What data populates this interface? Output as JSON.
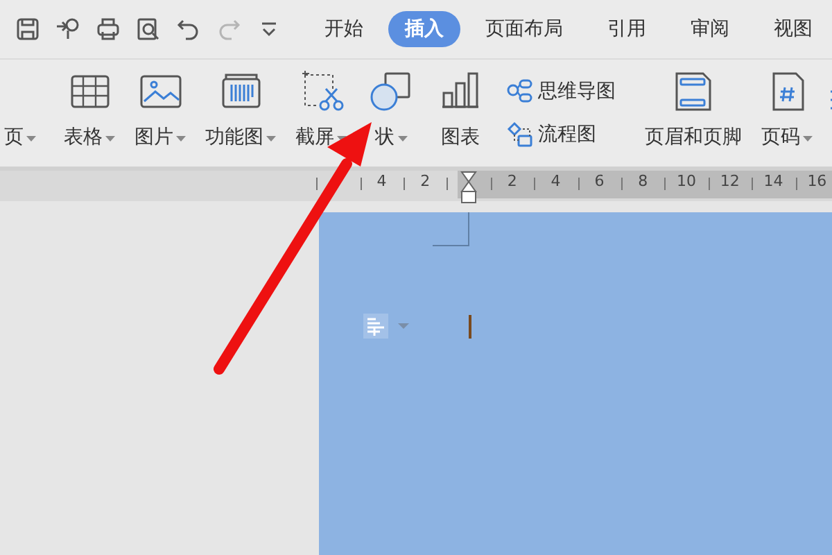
{
  "quick_access": [
    {
      "disabled": false
    },
    {
      "disabled": false
    },
    {
      "disabled": false
    },
    {
      "disabled": false
    },
    {
      "disabled": false
    },
    {
      "disabled": true
    },
    {
      "disabled": false
    }
  ],
  "tabs": [
    {
      "label": "开始",
      "selected": false
    },
    {
      "label": "插入",
      "selected": true
    },
    {
      "label": "页面布局",
      "selected": false
    },
    {
      "label": "引用",
      "selected": false
    },
    {
      "label": "审阅",
      "selected": false
    },
    {
      "label": "视图",
      "selected": false
    }
  ],
  "ribbon": {
    "sections": [
      {
        "items": [
          {
            "kind": "large",
            "label": "页",
            "dropdown": true
          }
        ]
      },
      {
        "items": [
          {
            "kind": "large",
            "label": "表格",
            "dropdown": true
          },
          {
            "kind": "large",
            "label": "图片",
            "dropdown": true
          },
          {
            "kind": "large",
            "label": "功能图",
            "dropdown": true
          },
          {
            "kind": "large",
            "label": "截屏",
            "dropdown": true
          },
          {
            "kind": "large",
            "label": "状",
            "dropdown": true
          },
          {
            "kind": "large",
            "label": "图表",
            "dropdown": false
          },
          {
            "kind": "small",
            "label": "思维导图"
          },
          {
            "kind": "small",
            "label": "流程图"
          }
        ]
      },
      {
        "items": [
          {
            "kind": "large",
            "label": "页眉和页脚",
            "dropdown": false
          },
          {
            "kind": "large",
            "label": "页码",
            "dropdown": true
          }
        ]
      }
    ]
  },
  "ruler": {
    "left_numbers": [
      "4",
      "2"
    ],
    "right_numbers": [
      "2",
      "4",
      "6",
      "8",
      "10",
      "12",
      "14",
      "16"
    ]
  }
}
